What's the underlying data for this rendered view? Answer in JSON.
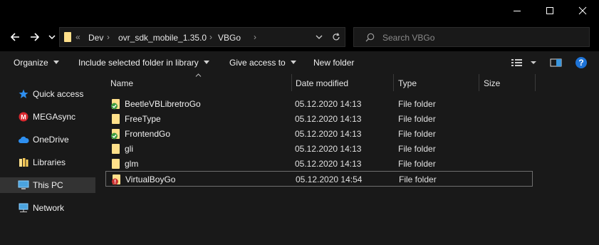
{
  "window": {
    "controls": {
      "minimize": "minimize-icon",
      "maximize": "maximize-icon",
      "close": "close-icon"
    }
  },
  "address": {
    "breadcrumbs": [
      "Dev",
      "ovr_sdk_mobile_1.35.0",
      "VBGo"
    ],
    "overflow_glyph": "«",
    "search_placeholder": "Search VBGo"
  },
  "toolbar": {
    "organize": "Organize",
    "include": "Include selected folder in library",
    "give_access": "Give access to",
    "new_folder": "New folder"
  },
  "nav": {
    "items": [
      {
        "label": "Quick access",
        "icon": "star-icon"
      },
      {
        "label": "MEGAsync",
        "icon": "mega-icon"
      },
      {
        "label": "OneDrive",
        "icon": "cloud-icon"
      },
      {
        "label": "Libraries",
        "icon": "library-icon"
      },
      {
        "label": "This PC",
        "icon": "computer-icon"
      },
      {
        "label": "Network",
        "icon": "network-icon"
      }
    ]
  },
  "columns": {
    "name": "Name",
    "date": "Date modified",
    "type": "Type",
    "size": "Size"
  },
  "files": [
    {
      "name": "BeetleVBLibretroGo",
      "date": "05.12.2020 14:13",
      "type": "File folder",
      "overlay": "synced"
    },
    {
      "name": "FreeType",
      "date": "05.12.2020 14:13",
      "type": "File folder",
      "overlay": "none"
    },
    {
      "name": "FrontendGo",
      "date": "05.12.2020 14:13",
      "type": "File folder",
      "overlay": "synced"
    },
    {
      "name": "gli",
      "date": "05.12.2020 14:13",
      "type": "File folder",
      "overlay": "none"
    },
    {
      "name": "glm",
      "date": "05.12.2020 14:13",
      "type": "File folder",
      "overlay": "none"
    },
    {
      "name": "VirtualBoyGo",
      "date": "05.12.2020 14:54",
      "type": "File folder",
      "overlay": "error"
    }
  ],
  "colors": {
    "accent": "#3a96dd",
    "folder": "#ffe08a",
    "mega": "#d9272e",
    "ok": "#5cb85c",
    "error": "#cc3333"
  }
}
